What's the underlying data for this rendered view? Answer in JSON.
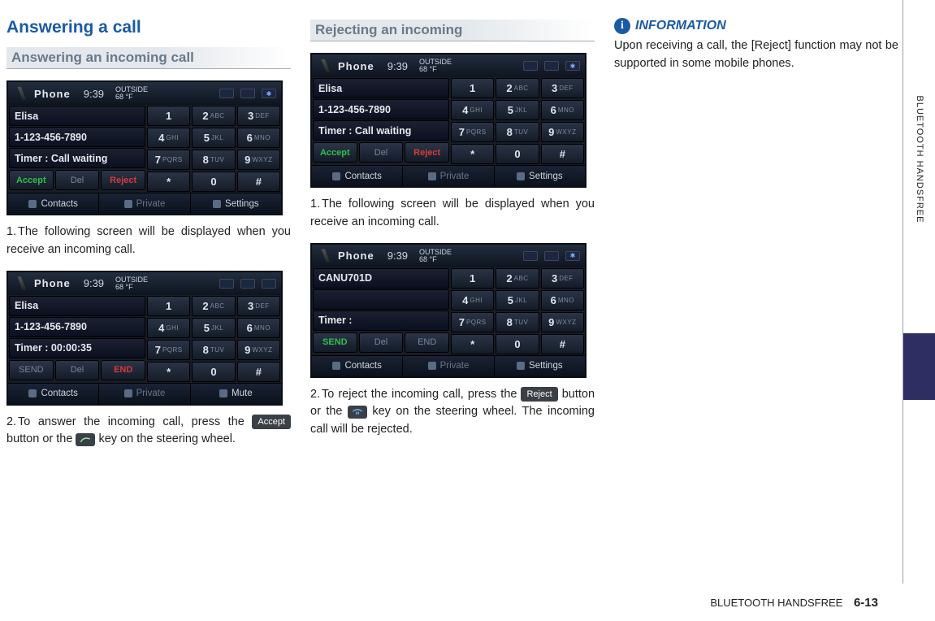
{
  "sideTab": "BLUETOOTH HANDSFREE",
  "footer": {
    "section": "BLUETOOTH HANDSFREE",
    "page": "6-13"
  },
  "col1": {
    "title": "Answering a call",
    "subtitle": "Answering an incoming call",
    "step1_a": "1.",
    "step1_b": "The following screen will be displayed when you receive an incoming call.",
    "step2_a": "2.",
    "step2_b1": "To answer the incoming call, press the ",
    "step2_btn": "Accept",
    "step2_b2": " button or the ",
    "step2_b3": " key on the steering wheel."
  },
  "col2": {
    "subtitle": "Rejecting an incoming",
    "step1_a": "1.",
    "step1_b": "The following screen will be displayed when you receive an incoming call.",
    "step2_a": "2.",
    "step2_b1": "To reject the incoming call, press the ",
    "step2_btn": "Reject",
    "step2_b2": " button or the ",
    "step2_b3": " key on the steering wheel.  The incoming call will be rejected."
  },
  "col3": {
    "infoLabel": "INFORMATION",
    "infoBody": "Upon receiving a call, the [Reject] function may not be supported in some mobile phones."
  },
  "screens": {
    "common": {
      "title": "Phone",
      "time": "9:39",
      "tempTop": "OUTSIDE",
      "tempVal": "68 °F",
      "keys": [
        [
          [
            "1",
            ""
          ],
          [
            "2",
            "ABC"
          ],
          [
            "3",
            "DEF"
          ]
        ],
        [
          [
            "4",
            "GHI"
          ],
          [
            "5",
            "JKL"
          ],
          [
            "6",
            "MNO"
          ]
        ],
        [
          [
            "7",
            "PQRS"
          ],
          [
            "8",
            "TUV"
          ],
          [
            "9",
            "WXYZ"
          ]
        ],
        [
          [
            "*",
            ""
          ],
          [
            "0",
            ""
          ],
          [
            "#",
            ""
          ]
        ]
      ],
      "bottom": {
        "contacts": "Contacts",
        "private": "Private",
        "settings": "Settings",
        "mute": "Mute"
      }
    },
    "s1": {
      "name": "Elisa",
      "number": "1-123-456-7890",
      "timer": "Timer : Call waiting",
      "actions": {
        "accept": "Accept",
        "del": "Del",
        "reject": "Reject"
      }
    },
    "s2": {
      "name": "Elisa",
      "number": "1-123-456-7890",
      "timer": "Timer : 00:00:35",
      "actions": {
        "send": "SEND",
        "del": "Del",
        "end": "END"
      }
    },
    "s3": {
      "name": "Elisa",
      "number": "1-123-456-7890",
      "timer": "Timer : Call waiting",
      "actions": {
        "accept": "Accept",
        "del": "Del",
        "reject": "Reject"
      }
    },
    "s4": {
      "name": "CANU701D",
      "number": "",
      "timer": "Timer :",
      "actions": {
        "send": "SEND",
        "del": "Del",
        "end": "END"
      }
    }
  }
}
